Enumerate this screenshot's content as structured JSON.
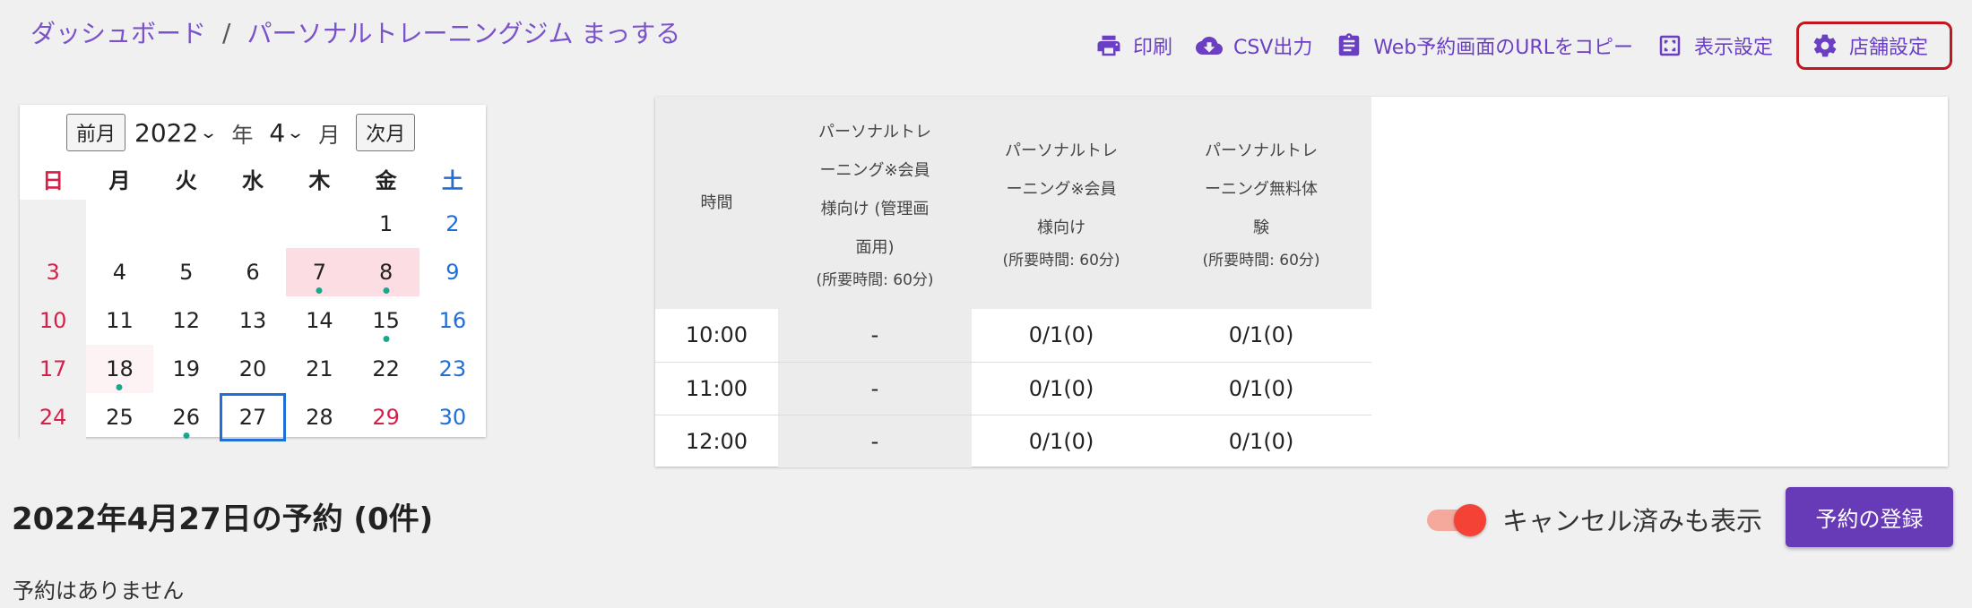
{
  "breadcrumb": {
    "root": "ダッシュボード",
    "sep": "/",
    "current": "パーソナルトレーニングジム まっする"
  },
  "toolbar": {
    "print": "印刷",
    "csv": "CSV出力",
    "copy_url": "Web予約画面のURLをコピー",
    "display": "表示設定",
    "store": "店舗設定"
  },
  "calendar": {
    "prev": "前月",
    "next": "次月",
    "year": "2022",
    "year_unit": "年",
    "month": "4",
    "month_unit": "月",
    "weekdays": [
      "日",
      "月",
      "火",
      "水",
      "木",
      "金",
      "土"
    ],
    "days": [
      "1",
      "2",
      "3",
      "4",
      "5",
      "6",
      "7",
      "8",
      "9",
      "10",
      "11",
      "12",
      "13",
      "14",
      "15",
      "16",
      "17",
      "18",
      "19",
      "20",
      "21",
      "22",
      "23",
      "24",
      "25",
      "26",
      "27",
      "28",
      "29",
      "30"
    ]
  },
  "schedule": {
    "time_header": "時間",
    "col_a": {
      "l1": "パーソナルトレ",
      "l2": "ーニング※会員",
      "l3": "様向け (管理画",
      "l4": "面用)",
      "dur": "(所要時間: 60分)"
    },
    "col_b": {
      "l1": "パーソナルトレ",
      "l2": "ーニング※会員",
      "l3": "様向け",
      "dur": "(所要時間: 60分)"
    },
    "col_c": {
      "l1": "パーソナルトレ",
      "l2": "ーニング無料体",
      "l3": "験",
      "dur": "(所要時間: 60分)"
    },
    "rows": [
      {
        "time": "10:00",
        "a": "-",
        "b": "0/1(0)",
        "c": "0/1(0)"
      },
      {
        "time": "11:00",
        "a": "-",
        "b": "0/1(0)",
        "c": "0/1(0)"
      },
      {
        "time": "12:00",
        "a": "-",
        "b": "0/1(0)",
        "c": "0/1(0)"
      }
    ]
  },
  "day_title": "2022年4月27日の予約 (0件)",
  "empty_text": "予約はありません",
  "show_cancelled": "キャンセル済みも表示",
  "register": "予約の登録",
  "colors": {
    "accent": "#673ab7",
    "toggle": "#f44336",
    "today": "#1f6fd6"
  }
}
